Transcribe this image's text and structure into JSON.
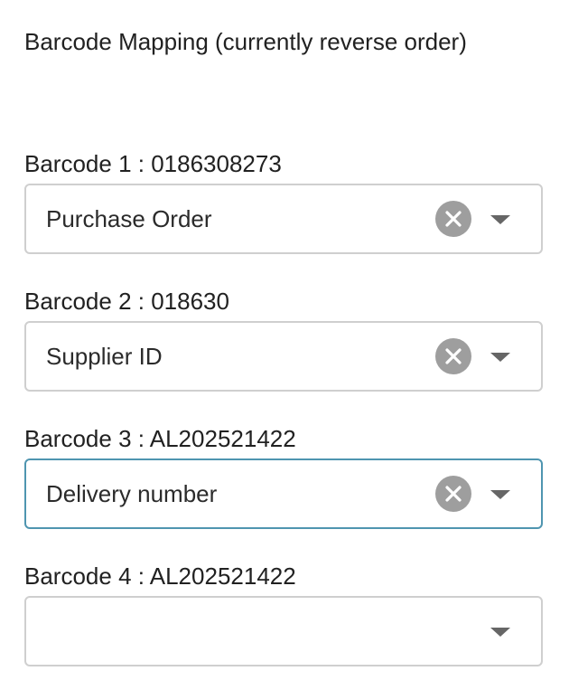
{
  "heading": "Barcode Mapping (currently reverse order)",
  "fields": [
    {
      "label": "Barcode 1 : 0186308273",
      "value": "Purchase Order"
    },
    {
      "label": "Barcode 2 : 018630",
      "value": "Supplier ID"
    },
    {
      "label": "Barcode 3 : AL202521422",
      "value": "Delivery number"
    },
    {
      "label": "Barcode 4 : AL202521422",
      "value": ""
    }
  ],
  "icons": {
    "clear": "clear-icon",
    "dropdown": "chevron-down-icon"
  },
  "colors": {
    "focus_border": "#4f95b0",
    "default_border": "#cfcfcf",
    "clear_icon_bg": "#9e9e9e",
    "dropdown_arrow": "#666666"
  }
}
